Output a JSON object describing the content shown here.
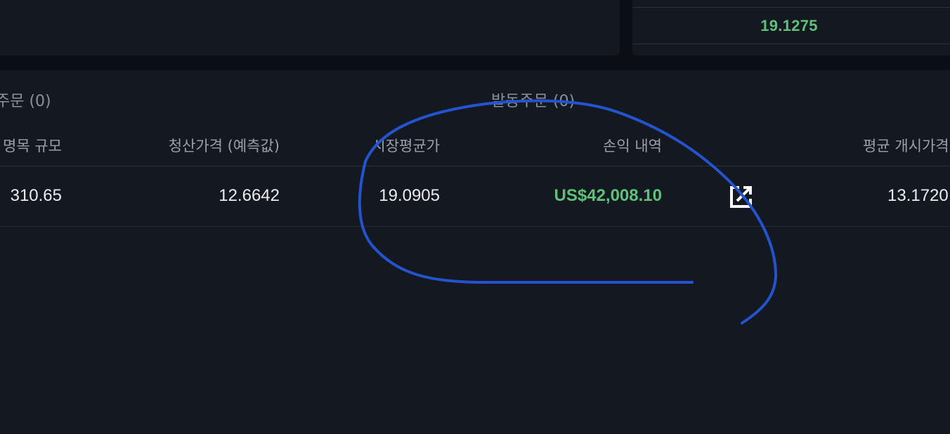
{
  "top_right": {
    "price": "19.1275"
  },
  "tabs": {
    "open_orders": "주문 (0)",
    "trigger_orders": "발동주문 (0)"
  },
  "columns": {
    "notional_size": "명목 규모",
    "liquidation_price": "청산가격 (예측값)",
    "mark_price": "시장평균가",
    "pnl": "손익 내역",
    "avg_entry_price": "평균 개시가격"
  },
  "position_row": {
    "notional_size": "310.65",
    "liquidation_price": "12.6642",
    "mark_price": "19.0905",
    "pnl": "US$42,008.10",
    "avg_entry_price": "13.1720"
  },
  "icons": {
    "share": "share-external-icon"
  },
  "colors": {
    "profit": "#5fc07a",
    "panel_bg": "#141821",
    "page_bg": "#0b0e15",
    "annotation": "#2453d0"
  }
}
